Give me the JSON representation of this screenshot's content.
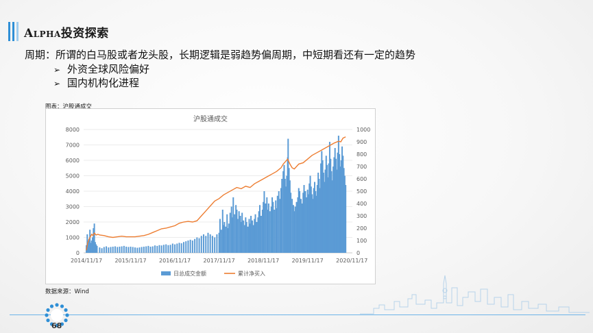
{
  "header": {
    "title_prefix": "Alpha",
    "title_suffix": "投资探索"
  },
  "content": {
    "headline": "周期：所谓的白马股或者龙头股，长期逻辑是弱趋势偏周期，中短期看还有一定的趋势",
    "bullets": [
      "外资全球风险偏好",
      "国内机构化进程"
    ]
  },
  "caption": "图表：沪股通成交",
  "source": "数据来源：Wind",
  "page_number": "68",
  "colors": {
    "bar": "#5b9bd5",
    "line": "#ed7d31",
    "accent": "#2f8fd6"
  },
  "chart_data": {
    "type": "bar",
    "title": "沪股通成交",
    "x_ticks": [
      "2014/11/17",
      "2015/11/17",
      "2016/11/17",
      "2017/11/17",
      "2018/11/17",
      "2019/11/17",
      "2020/11/17"
    ],
    "y_left_ticks": [
      "0",
      "1000",
      "2000",
      "3000",
      "4000",
      "5000",
      "6000",
      "7000",
      "8000"
    ],
    "y_right_ticks": [
      "0",
      "100",
      "200",
      "300",
      "400",
      "500",
      "600",
      "700",
      "800",
      "900",
      "1000"
    ],
    "ylim_left": [
      0,
      8000
    ],
    "ylim_right": [
      0,
      1000
    ],
    "grid": true,
    "legend_position": "bottom",
    "series": [
      {
        "name": "日总成交金额",
        "kind": "bar",
        "axis": "left",
        "points": [
          [
            0.0,
            500
          ],
          [
            0.02,
            1200
          ],
          [
            0.04,
            700
          ],
          [
            0.06,
            900
          ],
          [
            0.08,
            1500
          ],
          [
            0.1,
            650
          ],
          [
            0.12,
            800
          ],
          [
            0.14,
            1000
          ],
          [
            0.16,
            1600
          ],
          [
            0.18,
            1900
          ],
          [
            0.2,
            700
          ],
          [
            0.22,
            550
          ],
          [
            0.24,
            450
          ],
          [
            0.3,
            350
          ],
          [
            0.35,
            300
          ],
          [
            0.4,
            380
          ],
          [
            0.45,
            420
          ],
          [
            0.5,
            350
          ],
          [
            0.55,
            380
          ],
          [
            0.6,
            400
          ],
          [
            0.65,
            420
          ],
          [
            0.7,
            380
          ],
          [
            0.75,
            400
          ],
          [
            0.8,
            420
          ],
          [
            0.85,
            450
          ],
          [
            0.9,
            400
          ],
          [
            0.95,
            380
          ],
          [
            1.0,
            400
          ],
          [
            1.05,
            380
          ],
          [
            1.1,
            350
          ],
          [
            1.15,
            330
          ],
          [
            1.2,
            350
          ],
          [
            1.25,
            380
          ],
          [
            1.3,
            400
          ],
          [
            1.35,
            420
          ],
          [
            1.4,
            450
          ],
          [
            1.45,
            400
          ],
          [
            1.5,
            420
          ],
          [
            1.55,
            480
          ],
          [
            1.6,
            450
          ],
          [
            1.65,
            500
          ],
          [
            1.7,
            480
          ],
          [
            1.75,
            520
          ],
          [
            1.8,
            550
          ],
          [
            1.85,
            500
          ],
          [
            1.9,
            520
          ],
          [
            1.95,
            600
          ],
          [
            2.0,
            550
          ],
          [
            2.05,
            600
          ],
          [
            2.1,
            650
          ],
          [
            2.15,
            620
          ],
          [
            2.2,
            700
          ],
          [
            2.25,
            750
          ],
          [
            2.3,
            800
          ],
          [
            2.35,
            850
          ],
          [
            2.4,
            800
          ],
          [
            2.45,
            900
          ],
          [
            2.5,
            1000
          ],
          [
            2.55,
            950
          ],
          [
            2.6,
            1100
          ],
          [
            2.65,
            1200
          ],
          [
            2.7,
            1100
          ],
          [
            2.75,
            1300
          ],
          [
            2.8,
            1200
          ],
          [
            2.85,
            1100
          ],
          [
            2.9,
            1000
          ],
          [
            2.95,
            1200
          ],
          [
            3.0,
            1300
          ],
          [
            3.02,
            2200
          ],
          [
            3.05,
            1500
          ],
          [
            3.08,
            2800
          ],
          [
            3.1,
            1800
          ],
          [
            3.12,
            2000
          ],
          [
            3.15,
            1700
          ],
          [
            3.18,
            2500
          ],
          [
            3.2,
            1600
          ],
          [
            3.22,
            1900
          ],
          [
            3.25,
            2600
          ],
          [
            3.28,
            3000
          ],
          [
            3.3,
            2300
          ],
          [
            3.32,
            3600
          ],
          [
            3.35,
            2500
          ],
          [
            3.38,
            3100
          ],
          [
            3.4,
            2800
          ],
          [
            3.42,
            2200
          ],
          [
            3.45,
            2700
          ],
          [
            3.48,
            2400
          ],
          [
            3.5,
            2000
          ],
          [
            3.52,
            2600
          ],
          [
            3.55,
            2100
          ],
          [
            3.58,
            1800
          ],
          [
            3.6,
            2300
          ],
          [
            3.62,
            2000
          ],
          [
            3.65,
            1700
          ],
          [
            3.68,
            2200
          ],
          [
            3.7,
            1900
          ],
          [
            3.72,
            2400
          ],
          [
            3.75,
            2100
          ],
          [
            3.78,
            1800
          ],
          [
            3.8,
            2200
          ],
          [
            3.82,
            2500
          ],
          [
            3.85,
            2000
          ],
          [
            3.88,
            2300
          ],
          [
            3.9,
            2700
          ],
          [
            3.92,
            3100
          ],
          [
            3.95,
            2400
          ],
          [
            3.98,
            2800
          ],
          [
            4.0,
            3300
          ],
          [
            4.02,
            4000
          ],
          [
            4.05,
            3200
          ],
          [
            4.08,
            3600
          ],
          [
            4.1,
            2800
          ],
          [
            4.12,
            3200
          ],
          [
            4.15,
            2700
          ],
          [
            4.18,
            3000
          ],
          [
            4.2,
            3600
          ],
          [
            4.22,
            3300
          ],
          [
            4.25,
            2800
          ],
          [
            4.28,
            3400
          ],
          [
            4.3,
            2900
          ],
          [
            4.32,
            3700
          ],
          [
            4.35,
            4000
          ],
          [
            4.38,
            3500
          ],
          [
            4.4,
            4200
          ],
          [
            4.42,
            4800
          ],
          [
            4.45,
            5300
          ],
          [
            4.47,
            5700
          ],
          [
            4.49,
            4800
          ],
          [
            4.51,
            4300
          ],
          [
            4.53,
            5000
          ],
          [
            4.55,
            6200
          ],
          [
            4.56,
            7400
          ],
          [
            4.58,
            5500
          ],
          [
            4.6,
            4700
          ],
          [
            4.62,
            3900
          ],
          [
            4.65,
            3500
          ],
          [
            4.68,
            3100
          ],
          [
            4.7,
            2700
          ],
          [
            4.72,
            3000
          ],
          [
            4.75,
            3300
          ],
          [
            4.78,
            3600
          ],
          [
            4.8,
            4200
          ],
          [
            4.82,
            4000
          ],
          [
            4.85,
            3500
          ],
          [
            4.88,
            3200
          ],
          [
            4.9,
            3900
          ],
          [
            4.92,
            4400
          ],
          [
            4.95,
            4000
          ],
          [
            4.98,
            3600
          ],
          [
            5.0,
            4100
          ],
          [
            5.02,
            3800
          ],
          [
            5.04,
            4500
          ],
          [
            5.06,
            5000
          ],
          [
            5.08,
            4300
          ],
          [
            5.1,
            3800
          ],
          [
            5.12,
            3500
          ],
          [
            5.14,
            4200
          ],
          [
            5.16,
            4600
          ],
          [
            5.18,
            4000
          ],
          [
            5.2,
            3700
          ],
          [
            5.22,
            4400
          ],
          [
            5.24,
            5200
          ],
          [
            5.26,
            4800
          ],
          [
            5.28,
            4200
          ],
          [
            5.3,
            5800
          ],
          [
            5.32,
            6600
          ],
          [
            5.34,
            6000
          ],
          [
            5.36,
            5200
          ],
          [
            5.38,
            4600
          ],
          [
            5.4,
            5400
          ],
          [
            5.42,
            6300
          ],
          [
            5.44,
            5700
          ],
          [
            5.46,
            4900
          ],
          [
            5.48,
            5800
          ],
          [
            5.5,
            7200
          ],
          [
            5.52,
            6100
          ],
          [
            5.54,
            5300
          ],
          [
            5.56,
            4700
          ],
          [
            5.58,
            5600
          ],
          [
            5.6,
            6200
          ],
          [
            5.62,
            6800
          ],
          [
            5.64,
            6100
          ],
          [
            5.66,
            5400
          ],
          [
            5.68,
            6500
          ],
          [
            5.7,
            7600
          ],
          [
            5.72,
            6400
          ],
          [
            5.74,
            5600
          ],
          [
            5.76,
            6000
          ],
          [
            5.78,
            6900
          ],
          [
            5.8,
            6300
          ],
          [
            5.82,
            5500
          ],
          [
            5.84,
            5000
          ],
          [
            5.86,
            4400
          ]
        ]
      },
      {
        "name": "累计净买入",
        "kind": "line",
        "axis": "right",
        "points": [
          [
            0.0,
            20
          ],
          [
            0.03,
            80
          ],
          [
            0.06,
            110
          ],
          [
            0.09,
            130
          ],
          [
            0.12,
            150
          ],
          [
            0.15,
            140
          ],
          [
            0.18,
            160
          ],
          [
            0.22,
            145
          ],
          [
            0.26,
            150
          ],
          [
            0.3,
            145
          ],
          [
            0.4,
            140
          ],
          [
            0.5,
            130
          ],
          [
            0.6,
            125
          ],
          [
            0.7,
            130
          ],
          [
            0.8,
            135
          ],
          [
            0.9,
            130
          ],
          [
            1.0,
            130
          ],
          [
            1.1,
            130
          ],
          [
            1.2,
            135
          ],
          [
            1.3,
            140
          ],
          [
            1.4,
            150
          ],
          [
            1.5,
            165
          ],
          [
            1.6,
            180
          ],
          [
            1.7,
            195
          ],
          [
            1.8,
            200
          ],
          [
            1.9,
            210
          ],
          [
            2.0,
            220
          ],
          [
            2.1,
            240
          ],
          [
            2.2,
            250
          ],
          [
            2.3,
            255
          ],
          [
            2.4,
            250
          ],
          [
            2.5,
            260
          ],
          [
            2.6,
            300
          ],
          [
            2.7,
            340
          ],
          [
            2.8,
            380
          ],
          [
            2.9,
            420
          ],
          [
            3.0,
            440
          ],
          [
            3.1,
            470
          ],
          [
            3.2,
            490
          ],
          [
            3.3,
            510
          ],
          [
            3.4,
            530
          ],
          [
            3.5,
            520
          ],
          [
            3.6,
            540
          ],
          [
            3.7,
            530
          ],
          [
            3.8,
            560
          ],
          [
            3.9,
            580
          ],
          [
            4.0,
            600
          ],
          [
            4.1,
            620
          ],
          [
            4.2,
            640
          ],
          [
            4.3,
            660
          ],
          [
            4.4,
            690
          ],
          [
            4.45,
            720
          ],
          [
            4.5,
            740
          ],
          [
            4.55,
            760
          ],
          [
            4.6,
            720
          ],
          [
            4.65,
            690
          ],
          [
            4.7,
            680
          ],
          [
            4.8,
            720
          ],
          [
            4.9,
            730
          ],
          [
            5.0,
            760
          ],
          [
            5.1,
            790
          ],
          [
            5.2,
            810
          ],
          [
            5.3,
            830
          ],
          [
            5.4,
            850
          ],
          [
            5.5,
            870
          ],
          [
            5.6,
            890
          ],
          [
            5.7,
            905
          ],
          [
            5.75,
            900
          ],
          [
            5.8,
            930
          ],
          [
            5.86,
            940
          ]
        ]
      }
    ]
  }
}
